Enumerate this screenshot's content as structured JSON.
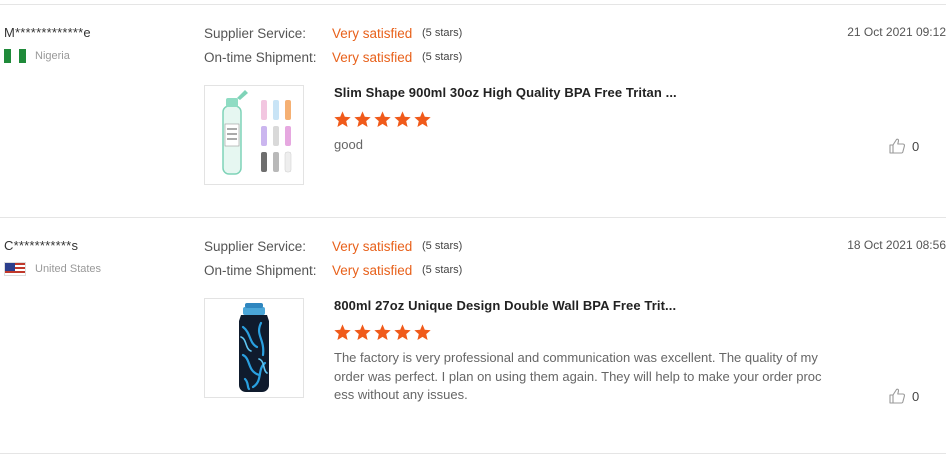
{
  "reviews": [
    {
      "user": "M*************e",
      "country": "Nigeria",
      "flag": "nigeria-flag",
      "date": "21 Oct 2021 09:12",
      "supplier_service": {
        "label": "Supplier Service:",
        "value": "Very satisfied",
        "stars": "(5 stars)"
      },
      "shipment": {
        "label": "On-time Shipment:",
        "value": "Very satisfied",
        "stars": "(5 stars)"
      },
      "product_title": "Slim Shape 900ml 30oz High Quality BPA Free Tritan ...",
      "rating": 5,
      "comment": "good",
      "likes": "0"
    },
    {
      "user": "C***********s",
      "country": "United States",
      "flag": "united-states-flag",
      "date": "18 Oct 2021 08:56",
      "supplier_service": {
        "label": "Supplier Service:",
        "value": "Very satisfied",
        "stars": "(5 stars)"
      },
      "shipment": {
        "label": "On-time Shipment:",
        "value": "Very satisfied",
        "stars": "(5 stars)"
      },
      "product_title": "800ml 27oz Unique Design Double Wall BPA Free Trit...",
      "rating": 5,
      "comment": "The factory is very professional and communication was excellent. The quality of my order was perfect. I plan on using them again. They will help to make your order process without any issues.",
      "likes": "0"
    }
  ],
  "colors": {
    "accent": "#e8611b",
    "star": "#f05a1a",
    "divider": "#e5e5e5"
  }
}
